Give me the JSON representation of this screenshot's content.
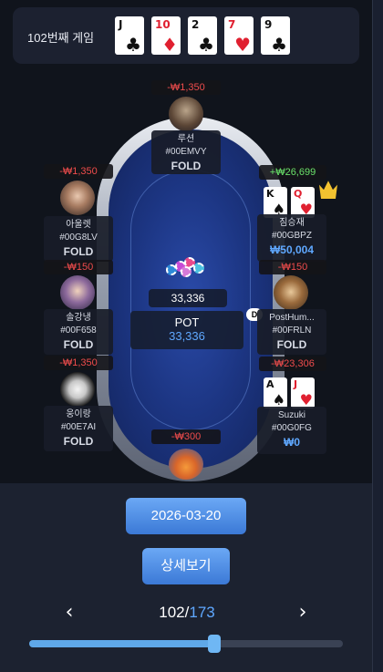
{
  "header": {
    "title": "102번째 게임",
    "community_cards": [
      {
        "rank": "J",
        "suit": "♣",
        "color": "black"
      },
      {
        "rank": "10",
        "suit": "♦",
        "color": "red"
      },
      {
        "rank": "2",
        "suit": "♣",
        "color": "black"
      },
      {
        "rank": "7",
        "suit": "♥",
        "color": "red"
      },
      {
        "rank": "9",
        "suit": "♣",
        "color": "black"
      }
    ]
  },
  "pot": {
    "bet_amount": "33,336",
    "label": "POT",
    "value": "33,336"
  },
  "dealer_label": "D",
  "seats": {
    "top": {
      "name": "루션",
      "id": "#00EMVY",
      "status": "FOLD",
      "delta": "-₩1,350"
    },
    "left1": {
      "name": "아울렛",
      "id": "#00G8LV",
      "status": "FOLD",
      "delta": "-₩1,350"
    },
    "left2": {
      "name": "솔강냉",
      "id": "#00F658",
      "status": "FOLD",
      "delta": "-₩150"
    },
    "left3": {
      "name": "웅이랑",
      "id": "#00E7AI",
      "status": "FOLD",
      "delta": "-₩1,350"
    },
    "right1": {
      "name": "짐승재",
      "id": "#00GBPZ",
      "stack": "₩50,004",
      "delta": "+₩26,699",
      "cards": [
        {
          "rank": "K",
          "suit": "♠",
          "color": "black"
        },
        {
          "rank": "Q",
          "suit": "♥",
          "color": "red"
        }
      ]
    },
    "right2": {
      "name": "PostHum...",
      "id": "#00FRLN",
      "status": "FOLD",
      "delta": "-₩150"
    },
    "right3": {
      "name": "Suzuki",
      "id": "#00G0FG",
      "stack": "₩0",
      "delta": "-₩23,306",
      "cards": [
        {
          "rank": "A",
          "suit": "♠",
          "color": "black"
        },
        {
          "rank": "J",
          "suit": "♥",
          "color": "red"
        }
      ]
    },
    "bottom": {
      "delta": "-₩300"
    }
  },
  "footer": {
    "date": "2026-03-20",
    "detail_label": "상세보기",
    "prev_icon": "chevron-left-icon",
    "next_icon": "chevron-right-icon",
    "current_page": "102",
    "separator": "/",
    "total_pages": "173",
    "progress": 0.59
  },
  "colors": {
    "accent": "#5fa8ff",
    "negative": "#ef4c4c",
    "positive": "#6be36b"
  }
}
